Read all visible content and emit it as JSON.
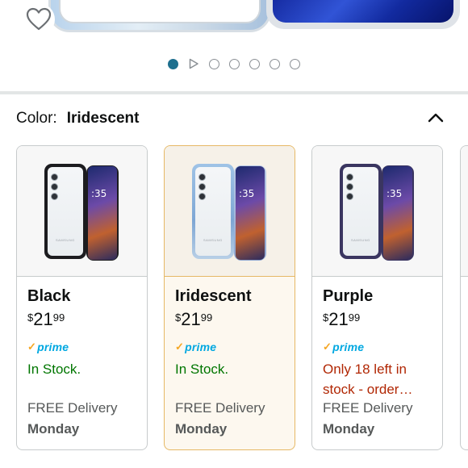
{
  "hero": {
    "carousel": {
      "total_slides": 7,
      "active_index": 0,
      "has_video": true
    }
  },
  "color_selector": {
    "label": "Color:",
    "selected_value": "Iridescent",
    "expanded": true
  },
  "variants": [
    {
      "name": "Black",
      "price_symbol": "$",
      "price_whole": "21",
      "price_fraction": "99",
      "prime_label": "prime",
      "availability": "In Stock.",
      "availability_color": "#007600",
      "delivery_label": "FREE Delivery",
      "delivery_day": "Monday",
      "selected": false,
      "case_color": "#1c1c1f"
    },
    {
      "name": "Iridescent",
      "price_symbol": "$",
      "price_whole": "21",
      "price_fraction": "99",
      "prime_label": "prime",
      "availability": "In Stock.",
      "availability_color": "#007600",
      "delivery_label": "FREE Delivery",
      "delivery_day": "Monday",
      "selected": true,
      "case_color": "#8fb4db"
    },
    {
      "name": "Purple",
      "price_symbol": "$",
      "price_whole": "21",
      "price_fraction": "99",
      "prime_label": "prime",
      "availability": "Only 18 left in stock - order…",
      "availability_color": "#b12704",
      "delivery_label": "FREE Delivery",
      "delivery_day": "Monday",
      "selected": false,
      "case_color": "#3a3560"
    }
  ],
  "phone_art": {
    "time": ":35",
    "brand": "SAMSUNG"
  },
  "colors": {
    "accent_teal": "#1d6f8e",
    "selected_border": "#e6b865",
    "prime_blue": "#00a8e1",
    "in_stock_green": "#007600",
    "low_stock_red": "#b12704"
  }
}
